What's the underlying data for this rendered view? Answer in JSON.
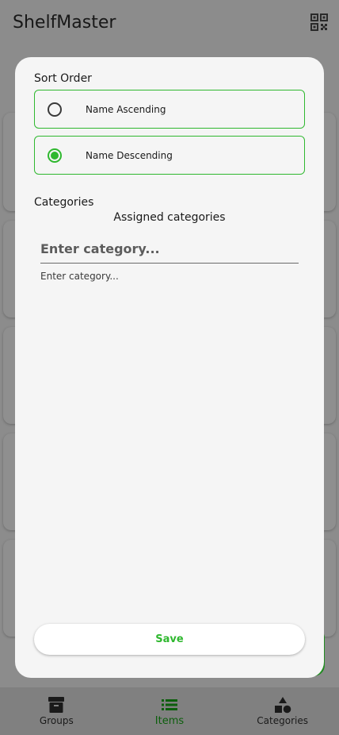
{
  "app": {
    "title": "ShelfMaster"
  },
  "colors": {
    "accent": "#2fb82f",
    "scrim": "#8c8c8c",
    "dialog_bg": "#f5f5f5"
  },
  "icons": {
    "app_bar": "qr-code-icon",
    "groups": "archive-box-icon",
    "items": "list-icon",
    "categories": "shapes-icon"
  },
  "dialog": {
    "sort_title": "Sort Order",
    "sort_options": [
      {
        "label": "Name Ascending",
        "selected": false
      },
      {
        "label": "Name Descending",
        "selected": true
      }
    ],
    "categories_title": "Categories",
    "assigned_title": "Assigned categories",
    "category_input_placeholder": "Enter category...",
    "category_helper_text": "Enter category...",
    "save_label": "Save"
  },
  "bottom_nav": {
    "items": [
      {
        "label": "Groups",
        "active": false
      },
      {
        "label": "Items",
        "active": true
      },
      {
        "label": "Categories",
        "active": false
      }
    ]
  }
}
